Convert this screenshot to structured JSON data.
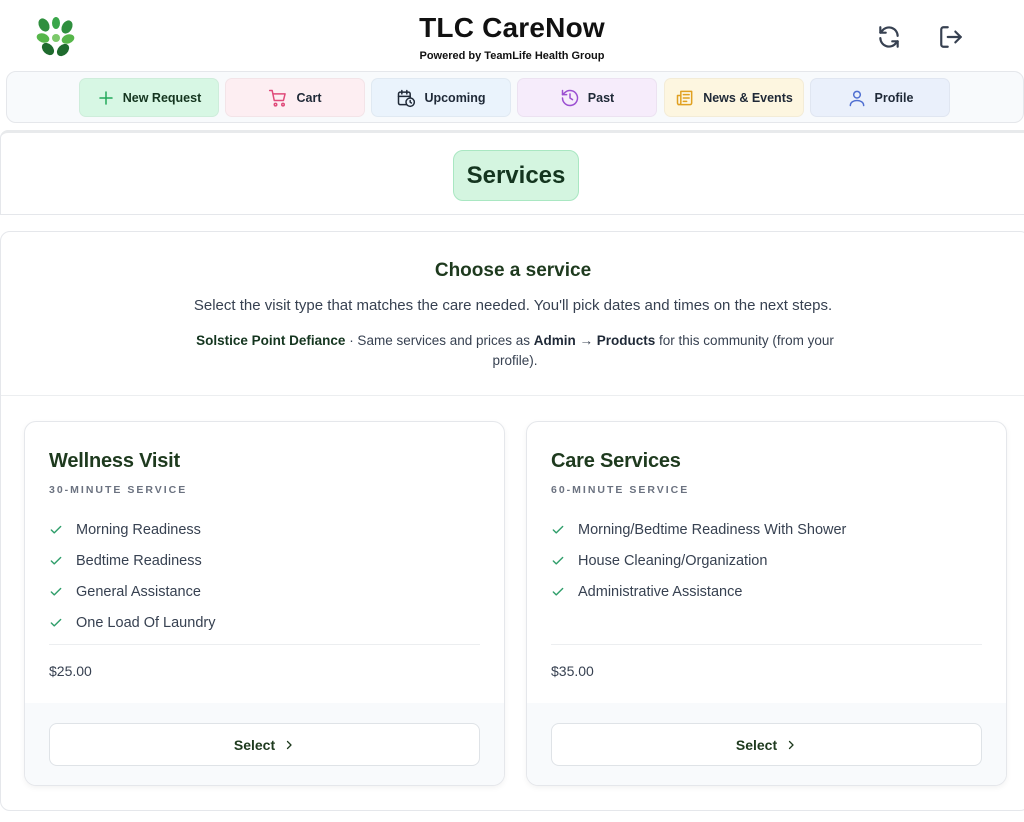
{
  "header": {
    "title": "TLC CareNow",
    "subtitle": "Powered by TeamLife Health Group",
    "logo_icon": "leaf-cluster-logo",
    "refresh_icon": "refresh-icon",
    "logout_icon": "logout-icon"
  },
  "nav": {
    "tabs": [
      {
        "label": "New Request",
        "icon": "plus-icon",
        "color": "#22a85a"
      },
      {
        "label": "Cart",
        "icon": "cart-icon",
        "color": "#e04a7a"
      },
      {
        "label": "Upcoming",
        "icon": "calendar-clock-icon",
        "color": "#1f2937"
      },
      {
        "label": "Past",
        "icon": "history-icon",
        "color": "#9b4fd1"
      },
      {
        "label": "News & Events",
        "icon": "newspaper-icon",
        "color": "#e0a020"
      },
      {
        "label": "Profile",
        "icon": "user-icon",
        "color": "#4f6fd1"
      }
    ]
  },
  "page": {
    "section_title": "Services"
  },
  "intro": {
    "title": "Choose a service",
    "description": "Select the visit type that matches the care needed. You'll pick dates and times on the next steps.",
    "community": "Solstice Point Defiance",
    "note_part1": " · Same services and prices as ",
    "admin_label": "Admin",
    "arrow": " → ",
    "products_label": "Products",
    "note_part2": " for this community (from your profile)."
  },
  "services": [
    {
      "title": "Wellness Visit",
      "duration": "30-MINUTE SERVICE",
      "features": [
        "Morning Readiness",
        "Bedtime Readiness",
        "General Assistance",
        "One Load Of Laundry"
      ],
      "price": "$25.00",
      "select_label": "Select"
    },
    {
      "title": "Care Services",
      "duration": "60-MINUTE SERVICE",
      "features": [
        "Morning/Bedtime Readiness With Shower",
        "House Cleaning/Organization",
        "Administrative Assistance"
      ],
      "price": "$35.00",
      "select_label": "Select"
    }
  ],
  "colors": {
    "brand_dark_green": "#1e3a1e",
    "check_green": "#2f9e6a",
    "pill_green_bg": "#d4f5e0"
  }
}
